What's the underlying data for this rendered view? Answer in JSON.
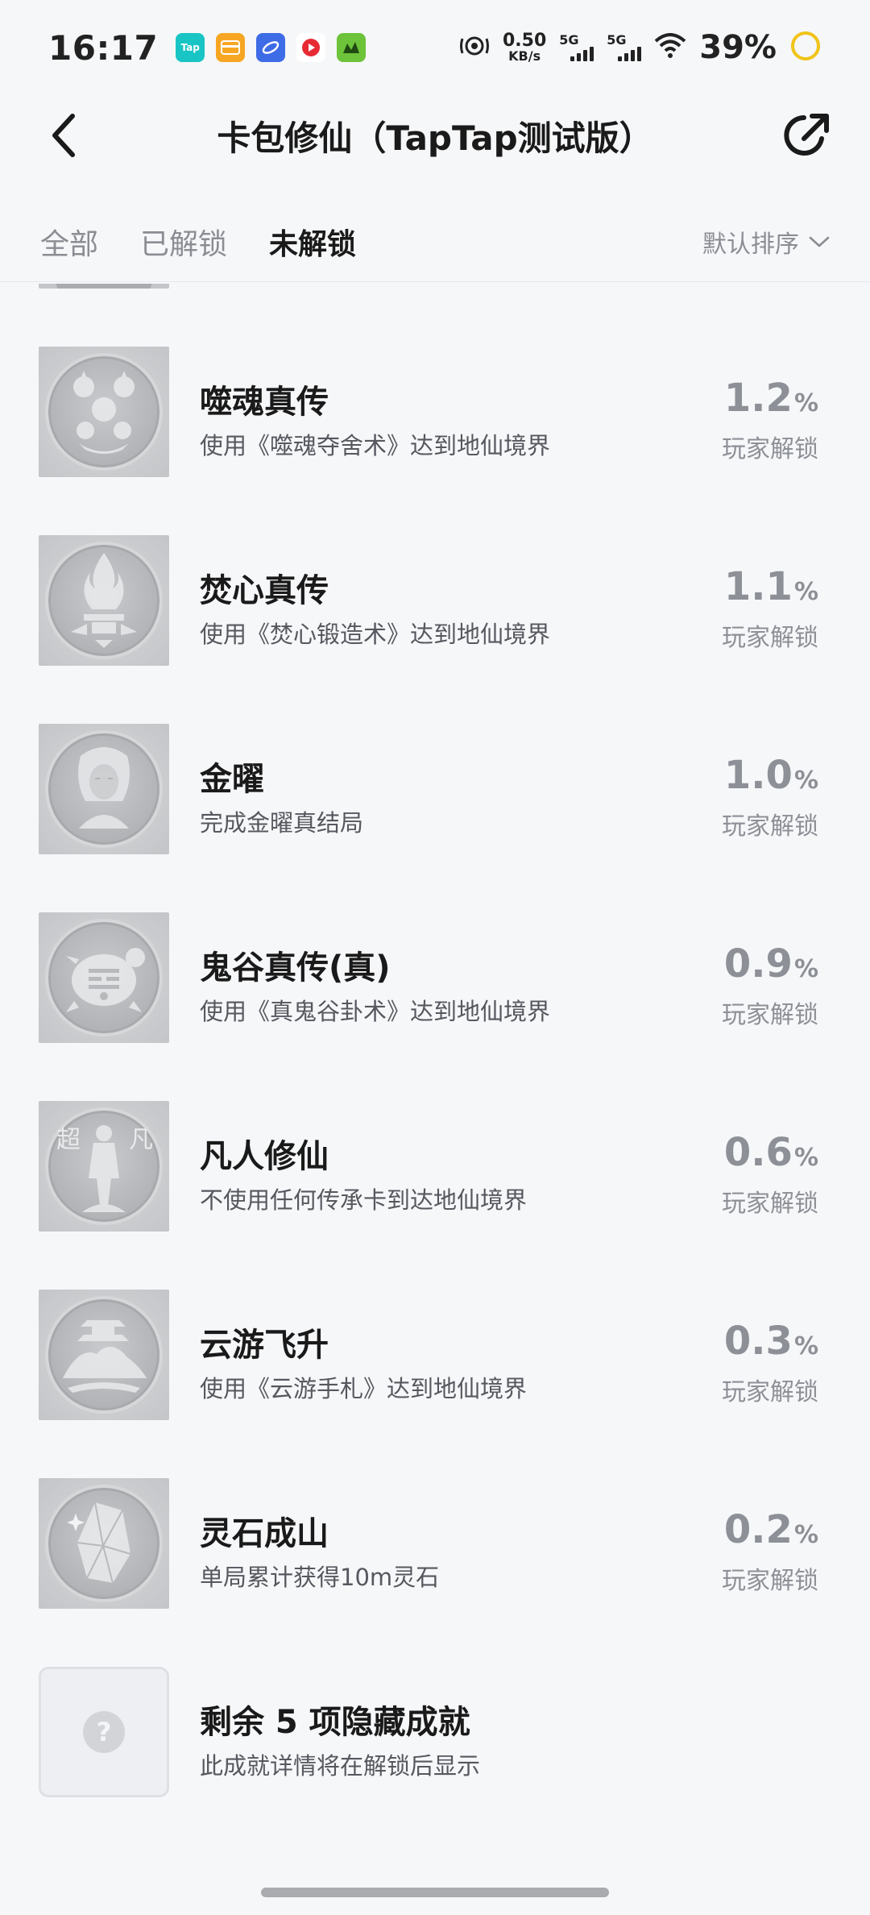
{
  "status_bar": {
    "time": "16:17",
    "app_icons": [
      {
        "name": "taptap-icon",
        "label": "Tap",
        "color": "#18c4c4"
      },
      {
        "name": "wallet-icon",
        "label": "",
        "color": "#f7a623"
      },
      {
        "name": "browser-icon",
        "label": "",
        "color": "#3e6be6"
      },
      {
        "name": "video-icon",
        "label": "",
        "color": "#ffffff"
      },
      {
        "name": "game-icon",
        "label": "",
        "color": "#6dc33a"
      }
    ],
    "net_speed_value": "0.50",
    "net_speed_unit": "KB/s",
    "sim1_label": "5G",
    "sim2_label": "5G",
    "battery": "39%"
  },
  "header": {
    "title": "卡包修仙（TapTap测试版）"
  },
  "tabs": [
    {
      "label": "全部",
      "active": false
    },
    {
      "label": "已解锁",
      "active": false
    },
    {
      "label": "未解锁",
      "active": true
    }
  ],
  "sort": {
    "label": "默认排序"
  },
  "achievements": [
    {
      "name": "噬魂真传",
      "desc": "使用《噬魂夺舍术》达到地仙境界",
      "percent": "1.2",
      "unit": "%",
      "unlock_label": "玩家解锁",
      "icon": "soul-devour-badge-icon"
    },
    {
      "name": "焚心真传",
      "desc": "使用《焚心锻造术》达到地仙境界",
      "percent": "1.1",
      "unit": "%",
      "unlock_label": "玩家解锁",
      "icon": "flame-forge-badge-icon"
    },
    {
      "name": "金曜",
      "desc": "完成金曜真结局",
      "percent": "1.0",
      "unit": "%",
      "unlock_label": "玩家解锁",
      "icon": "portrait-badge-icon"
    },
    {
      "name": "鬼谷真传(真)",
      "desc": "使用《真鬼谷卦术》达到地仙境界",
      "percent": "0.9",
      "unit": "%",
      "unlock_label": "玩家解锁",
      "icon": "turtle-bagua-badge-icon"
    },
    {
      "name": "凡人修仙",
      "desc": "不使用任何传承卡到达地仙境界",
      "percent": "0.6",
      "unit": "%",
      "unlock_label": "玩家解锁",
      "icon": "mortal-figure-badge-icon",
      "badge_text_left": "超",
      "badge_text_right": "凡"
    },
    {
      "name": "云游飞升",
      "desc": "使用《云游手札》达到地仙境界",
      "percent": "0.3",
      "unit": "%",
      "unlock_label": "玩家解锁",
      "icon": "mountain-pavilion-badge-icon"
    },
    {
      "name": "灵石成山",
      "desc": "单局累计获得10m灵石",
      "percent": "0.2",
      "unit": "%",
      "unlock_label": "玩家解锁",
      "icon": "crystal-badge-icon"
    }
  ],
  "hidden_section": {
    "title": "剩余 5 项隐藏成就",
    "desc": "此成就详情将在解锁后显示",
    "icon_glyph": "?"
  }
}
